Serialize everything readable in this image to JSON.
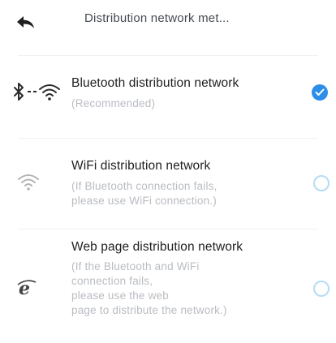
{
  "header": {
    "title": "Distribution network met..."
  },
  "options": [
    {
      "title": "Bluetooth distribution network",
      "description": "(Recommended)",
      "icon": "bluetooth-wifi-icon",
      "selected": true
    },
    {
      "title": "WiFi distribution network",
      "description": "(If Bluetooth connection fails,\nplease use WiFi connection.)",
      "icon": "wifi-icon",
      "selected": false
    },
    {
      "title": "Web page distribution network",
      "description": "(If the Bluetooth and WiFi\nconnection fails,\nplease use the web\npage to distribute the network.)",
      "icon": "web-browser-icon",
      "selected": false
    }
  ],
  "colors": {
    "accent": "#2d8ee9",
    "radio_unselected_border": "#b5dcf6",
    "secondary_text": "#b9bcc2"
  }
}
